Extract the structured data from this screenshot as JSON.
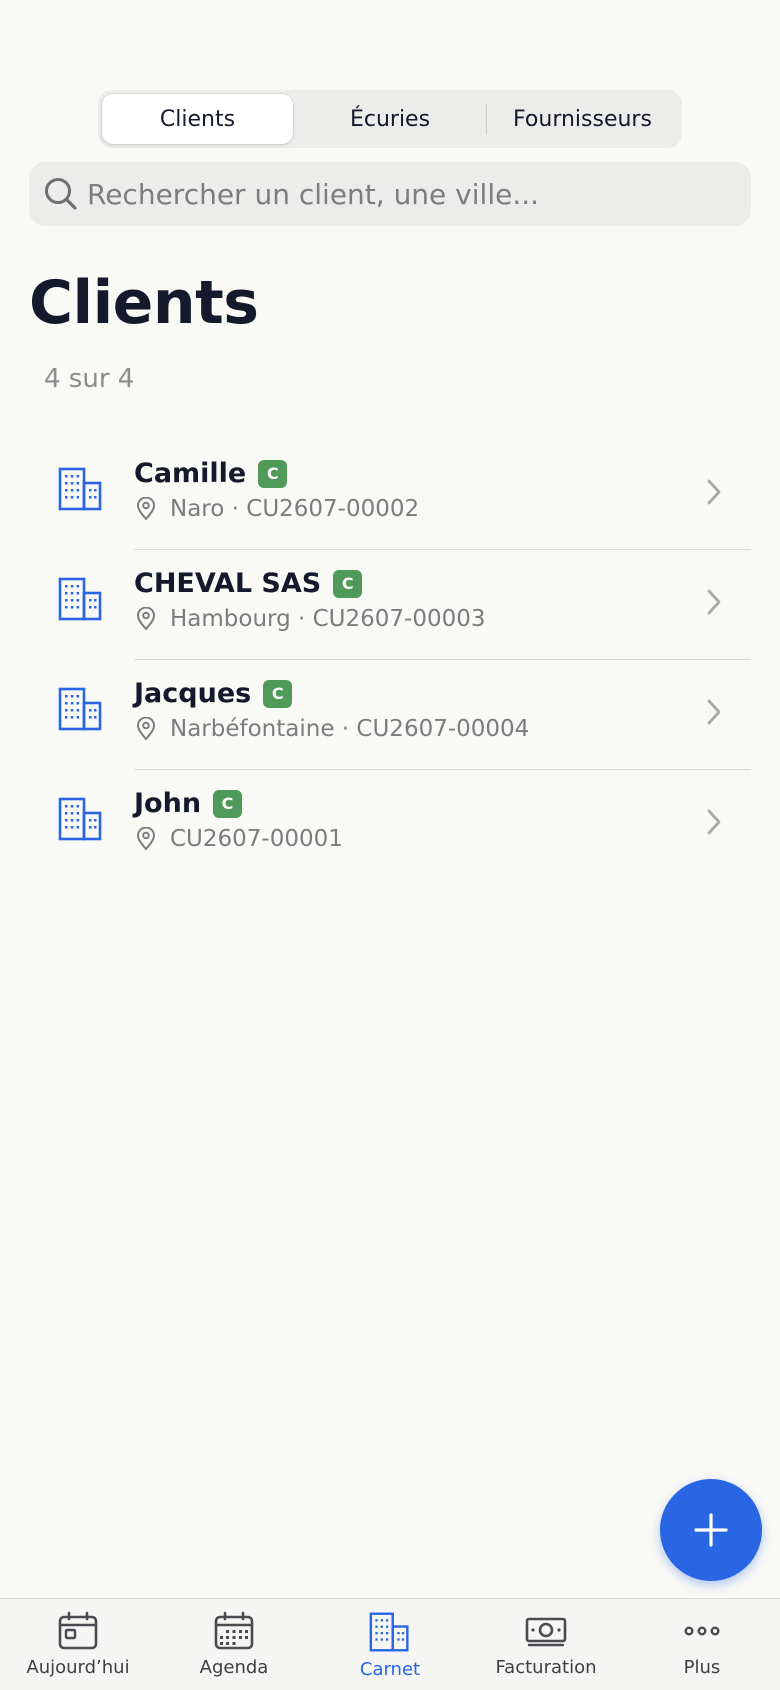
{
  "segmented": {
    "tabs": [
      {
        "label": "Clients",
        "active": true
      },
      {
        "label": "Écuries",
        "active": false
      },
      {
        "label": "Fournisseurs",
        "active": false
      }
    ]
  },
  "search": {
    "placeholder": "Rechercher un client, une ville...",
    "icon": "search-icon"
  },
  "page": {
    "title": "Clients",
    "count": "4 sur 4"
  },
  "clients": [
    {
      "name": "Camille",
      "badge": "C",
      "meta": "Naro · CU2607-00002"
    },
    {
      "name": "CHEVAL SAS",
      "badge": "C",
      "meta": "Hambourg · CU2607-00003"
    },
    {
      "name": "Jacques",
      "badge": "C",
      "meta": "Narbéfontaine · CU2607-00004"
    },
    {
      "name": "John",
      "badge": "C",
      "meta": "CU2607-00001"
    }
  ],
  "fab": {
    "icon": "plus-icon"
  },
  "tabbar": {
    "items": [
      {
        "label": "Aujourd’hui",
        "icon": "calendar-day-icon",
        "active": false
      },
      {
        "label": "Agenda",
        "icon": "calendar-grid-icon",
        "active": false
      },
      {
        "label": "Carnet",
        "icon": "building-icon",
        "active": true
      },
      {
        "label": "Facturation",
        "icon": "banknote-icon",
        "active": false
      },
      {
        "label": "Plus",
        "icon": "more-dots-icon",
        "active": false
      }
    ]
  },
  "colors": {
    "accent": "#2866e4",
    "badge": "#4f9a59",
    "background": "#f9f9f6",
    "text": "#141a2b",
    "muted": "#7c7c80"
  }
}
